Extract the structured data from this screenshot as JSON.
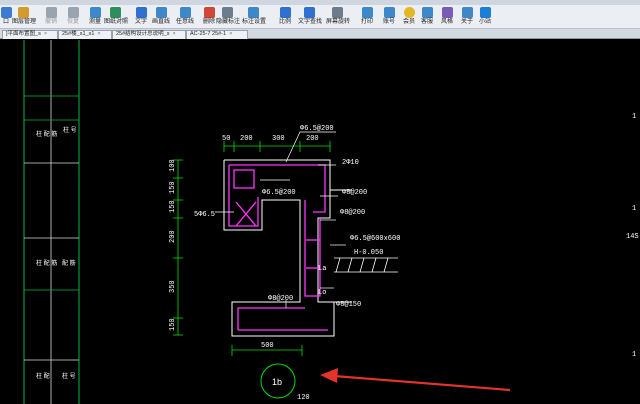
{
  "window": {
    "title": ""
  },
  "toolbar": {
    "items": [
      {
        "label": "口",
        "icon": "partial-icon",
        "enabled": true
      },
      {
        "label": "图层管理",
        "icon": "layers-icon",
        "enabled": true
      },
      {
        "label": "撤销",
        "icon": "undo-icon",
        "enabled": false
      },
      {
        "label": "恢复",
        "icon": "redo-icon",
        "enabled": false
      },
      {
        "label": "测量",
        "icon": "measure-icon",
        "enabled": true
      },
      {
        "label": "图纸对照",
        "icon": "compare-icon",
        "enabled": true
      },
      {
        "label": "文字",
        "icon": "text-icon",
        "enabled": true
      },
      {
        "label": "画直线",
        "icon": "line-icon",
        "enabled": true
      },
      {
        "label": "任意线",
        "icon": "freehand-icon",
        "enabled": true
      },
      {
        "label": "删除",
        "icon": "delete-icon",
        "enabled": true
      },
      {
        "label": "隐藏标注",
        "icon": "hide-annotation-icon",
        "enabled": true
      },
      {
        "label": "标注设置",
        "icon": "annotation-settings-icon",
        "enabled": true
      },
      {
        "label": "比例",
        "icon": "scale-icon",
        "enabled": true
      },
      {
        "label": "文字查找",
        "icon": "text-search-icon",
        "enabled": true
      },
      {
        "label": "屏幕旋转",
        "icon": "rotate-screen-icon",
        "enabled": true
      },
      {
        "label": "打印",
        "icon": "print-icon",
        "enabled": true
      },
      {
        "label": "账号",
        "icon": "account-icon",
        "enabled": true
      },
      {
        "label": "会员",
        "icon": "vip-icon",
        "enabled": true
      },
      {
        "label": "客服",
        "icon": "support-icon",
        "enabled": true
      },
      {
        "label": "风格",
        "icon": "style-icon",
        "enabled": true
      },
      {
        "label": "关于",
        "icon": "about-icon",
        "enabled": true
      },
      {
        "label": "小站",
        "icon": "station-icon",
        "enabled": true
      }
    ]
  },
  "tabs": [
    {
      "label": "]平面布置图_s"
    },
    {
      "label": "25#楼_s1_s1"
    },
    {
      "label": "25#结构设计总说明_s"
    },
    {
      "label": "AC-25-7 25#-1"
    }
  ],
  "drawing": {
    "dims_top": [
      "50",
      "200",
      "300",
      "200"
    ],
    "dims_left": [
      "100",
      "150",
      "150",
      "200",
      "350",
      "150"
    ],
    "dim_bottom": "500",
    "labels": {
      "top_bar": "Φ6.5@200",
      "corner_bars": "2Φ10",
      "inner_stirrup": "Φ6.5@200",
      "ties_upper": "Φ8@200",
      "ties_lower": "Φ8@200",
      "left_bars": "5Φ6.5",
      "opening": "Φ6.5@600x600",
      "elevation": "H-0.050",
      "anchor_upper": "La",
      "anchor_lower": "Lo",
      "bottom_bar": "Φ8@200",
      "bottom_right": "Φ8@150",
      "section_mark": "1b",
      "bottom_text": "120",
      "right_edge_1": "1",
      "right_edge_2": "1",
      "right_edge_3": "14S 1",
      "right_edge_4": "1"
    },
    "left_panel": {
      "cell_top_left": "柱\n配\n筋",
      "cell_top_right": "柱\n号",
      "cell_mid_left": "柱\n配\n筋",
      "cell_mid_right": "配\n筋",
      "cell_bot_left": "柱\n配",
      "cell_bot_right": "柱\n号"
    },
    "colors": {
      "background": "#000000",
      "dimension": "#00ff00",
      "structure": "#ffffff",
      "rebar": "#ff33ff",
      "text": "#ffffff",
      "panel_lines": "#00cc33",
      "arrow": "#e0352b"
    }
  }
}
